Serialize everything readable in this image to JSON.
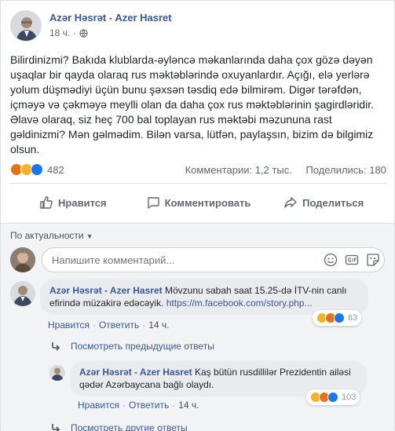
{
  "post": {
    "author": "Azər Həsrət - Azer Hasret",
    "time": "18 ч.",
    "dot": "·",
    "text": "Bilirdinizmi? Bakıda klublarda-əyləncə məkanlarında daha çox gözə dəyən uşaqlar bir qayda olaraq rus məktəblərində oxuyanlardır. Açığı, elə yerlərə yolum düşmədiyi üçün bunu şəxsən təsdiq edə bilmirəm. Digər tərəfdən, içməyə və çəkməyə meylli olan da daha çox rus məktəblərinin şagirdləridir. Əlavə olaraq, siz heç 700 bal toplayan rus məktəbi məzununa rast gəldinizmi? Mən gəlmədim. Bilən varsa, lütfən, paylaşsın, bizim də bilgimiz olsun.",
    "reaction_count": "482",
    "comments_count": "Комментарии: 1,2 тыс.",
    "shares_count": "Поделились: 180"
  },
  "actions": {
    "like": "Нравится",
    "comment": "Комментировать",
    "share": "Поделиться"
  },
  "comments_section": {
    "sort_label": "По актуальности",
    "input_placeholder": "Напишите комментарий..."
  },
  "comments": [
    {
      "author": "Azər Həsrət - Azer Hasret",
      "text": "Mövzunu sabah saat 15.25-də İTV-nin canlı efirində müzakirə edəcəyik.",
      "link": "https://m.facebook.com/story.php...",
      "like": "Нравится",
      "reply": "Ответить",
      "time": "14 ч.",
      "reaction_count": "63"
    }
  ],
  "replies": {
    "prev_label": "Посмотреть предыдущие ответы",
    "more_label": "Посмотреть другие ответы",
    "items": [
      {
        "author": "Azər Həsrət - Azer Hasret",
        "text": "Kaş bütün rusdillilər Prezidentin ailəsi qədər Azərbaycana bağlı olaydı.",
        "like": "Нравится",
        "reply": "Ответить",
        "time": "14 ч.",
        "reaction_count": "103"
      }
    ]
  },
  "icons": {
    "reactions": [
      "angry-icon",
      "haha-icon",
      "like-icon"
    ],
    "composer": [
      "emoji-icon",
      "gif-icon",
      "sticker-icon"
    ]
  },
  "colors": {
    "link": "#385898",
    "like_blue": "#1877f2",
    "haha_yellow": "#f7b125",
    "angry_orange": "#e9710f"
  }
}
